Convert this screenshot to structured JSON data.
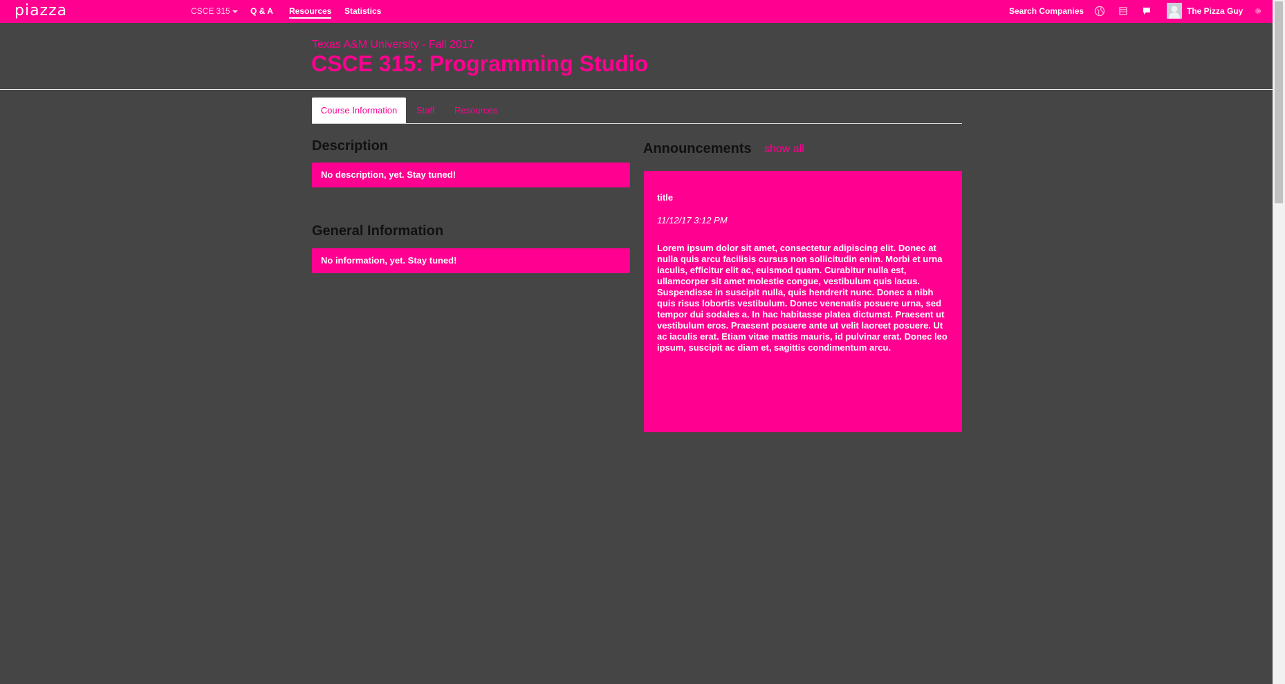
{
  "app": {
    "logo_text": "piazza",
    "brand_color": "#ff0090",
    "background_color": "#454545"
  },
  "topnav": {
    "course_selector": "CSCE 315",
    "links": [
      "Q & A",
      "Resources",
      "Statistics"
    ],
    "active_link": "Resources",
    "search_companies": "Search Companies",
    "user_name": "The Pizza Guy",
    "icons": [
      "globe-icon",
      "calendar-icon",
      "chat-icon",
      "settings-gear-icon"
    ]
  },
  "course": {
    "subtitle": "Texas A&M University - Fall 2017",
    "title": "CSCE 315: Programming Studio"
  },
  "tabs": [
    {
      "label": "Course Information",
      "active": true
    },
    {
      "label": "Staff",
      "active": false
    },
    {
      "label": "Resources",
      "active": false
    }
  ],
  "description": {
    "heading": "Description",
    "text": "No description, yet. Stay tuned!"
  },
  "general_information": {
    "heading": "General Information",
    "text": "No information, yet. Stay tuned!"
  },
  "announcements": {
    "heading": "Announcements",
    "show_all": "show all",
    "items": [
      {
        "title": "title",
        "date": "11/12/17 3:12 PM",
        "body": "Lorem ipsum dolor sit amet, consectetur adipiscing elit. Donec at nulla quis arcu facilisis cursus non sollicitudin enim. Morbi et urna iaculis, efficitur elit ac, euismod quam. Curabitur nulla est, ullamcorper sit amet molestie congue, vestibulum quis lacus. Suspendisse in suscipit nulla, quis hendrerit nunc. Donec a nibh quis risus lobortis vestibulum. Donec venenatis posuere urna, sed tempor dui sodales a. In hac habitasse platea dictumst. Praesent ut vestibulum eros. Praesent posuere ante ut velit laoreet posuere. Ut ac iaculis erat. Etiam vitae mattis mauris, id pulvinar erat. Donec leo ipsum, suscipit ac diam et, sagittis condimentum arcu."
      }
    ]
  }
}
